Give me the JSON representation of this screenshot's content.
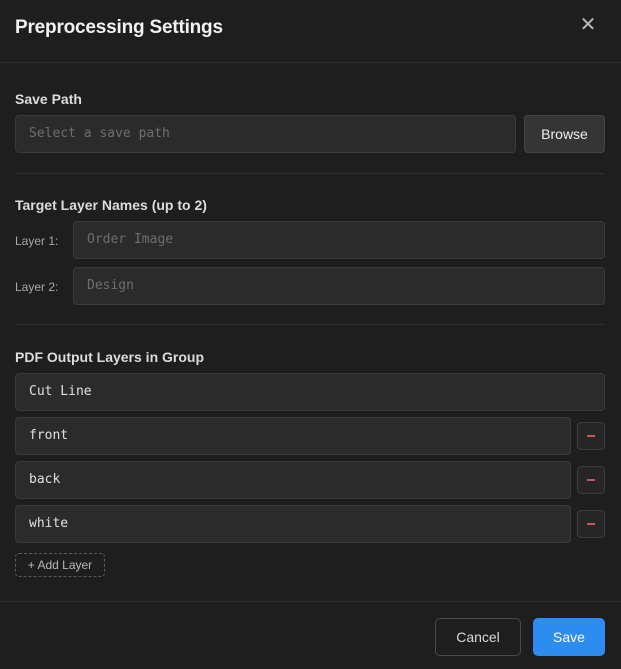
{
  "dialog": {
    "title": "Preprocessing Settings",
    "close_icon": "close-icon",
    "close_glyph": "✕"
  },
  "save_path": {
    "label": "Save Path",
    "placeholder": "Select a save path",
    "value": "",
    "browse_label": "Browse"
  },
  "target_layers": {
    "label": "Target Layer Names (up to 2)",
    "rows": [
      {
        "label": "Layer 1:",
        "placeholder": "Order Image",
        "value": ""
      },
      {
        "label": "Layer 2:",
        "placeholder": "Design",
        "value": ""
      }
    ]
  },
  "output_layers": {
    "label": "PDF Output Layers in Group",
    "items": [
      {
        "value": "Cut Line",
        "removable": false
      },
      {
        "value": "front",
        "removable": true,
        "remove_icon": "minus-icon"
      },
      {
        "value": "back",
        "removable": true,
        "remove_icon": "minus-icon"
      },
      {
        "value": "white",
        "removable": true,
        "remove_icon": "minus-icon"
      }
    ],
    "add_label": "+ Add Layer"
  },
  "footer": {
    "cancel_label": "Cancel",
    "save_label": "Save"
  },
  "colors": {
    "background": "#1e1e1e",
    "input_bg": "#2b2b2b",
    "accent": "#2d8cf0",
    "remove": "#c25a5a"
  }
}
